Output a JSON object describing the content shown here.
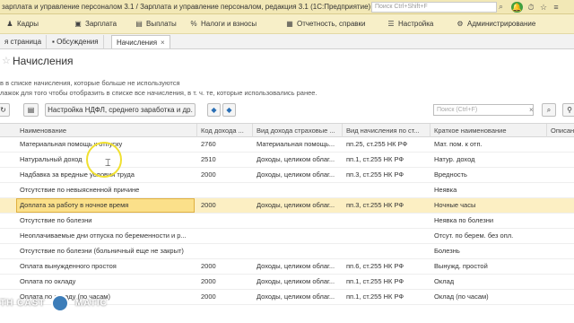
{
  "titlebar": {
    "title": "зарплата и управление персоналом 3.1 / Зарплата и управление персоналом, редакция 3.1  (1С:Предприятие)",
    "search_placeholder": "Поиск Ctrl+Shift+F"
  },
  "menubar": {
    "items": [
      {
        "label": "Кадры",
        "icon": "people-icon"
      },
      {
        "label": "Зарплата",
        "icon": "wallet-icon"
      },
      {
        "label": "Выплаты",
        "icon": "payments-icon"
      },
      {
        "label": "Налоги и взносы",
        "icon": "percent-icon"
      },
      {
        "label": "Отчетность, справки",
        "icon": "report-icon"
      },
      {
        "label": "Настройка",
        "icon": "settings-icon"
      },
      {
        "label": "Администрирование",
        "icon": "admin-icon"
      }
    ]
  },
  "tabs": [
    {
      "label": "я страница"
    },
    {
      "label": "Обсуждения"
    },
    {
      "label": "Начисления"
    }
  ],
  "page": {
    "title": "Начисления",
    "note1": "в в списке начисления, которые больше не используются",
    "note2": "лажок для того чтобы отобразить в списке все начисления, в т. ч. те, которые использовались ранее."
  },
  "toolbar": {
    "settings_button": "Настройка НДФЛ, среднего заработка и др.",
    "filter_placeholder": "Поиск (Ctrl+F)"
  },
  "table": {
    "columns": [
      "Наименование",
      "Код дохода ...",
      "Вид дохода страховые ...",
      "Вид начисления по ст...",
      "Краткое наименование",
      "Описан"
    ],
    "rows": [
      {
        "name": "Материальная помощь к отпуску",
        "code": "2760",
        "vid": "Материальная помощь...",
        "nach": "пп.25, ст.255 НК РФ",
        "short": "Мат. пом. к отп."
      },
      {
        "name": "Натуральный доход",
        "code": "2510",
        "vid": "Доходы, целиком облаг...",
        "nach": "пп.1, ст.255 НК РФ",
        "short": "Натур. доход"
      },
      {
        "name": "Надбавка за вредные условия труда",
        "code": "2000",
        "vid": "Доходы, целиком облаг...",
        "nach": "пп.3, ст.255 НК РФ",
        "short": "Вредность"
      },
      {
        "name": "Отсутствие по невыясненной причине",
        "code": "",
        "vid": "",
        "nach": "",
        "short": "Неявка"
      },
      {
        "name": "Доплата за работу в ночное время",
        "code": "2000",
        "vid": "Доходы, целиком облаг...",
        "nach": "пп.3, ст.255 НК РФ",
        "short": "Ночные часы"
      },
      {
        "name": "Отсутствие по болезни",
        "code": "",
        "vid": "",
        "nach": "",
        "short": "Неявка по болезни"
      },
      {
        "name": "Неоплачиваемые дни отпуска по беременности и р...",
        "code": "",
        "vid": "",
        "nach": "",
        "short": "Отсут. по берем. без опл."
      },
      {
        "name": "Отсутствие по болезни (больничный еще не закрыт)",
        "code": "",
        "vid": "",
        "nach": "",
        "short": "Болезнь"
      },
      {
        "name": "Оплата вынужденного простоя",
        "code": "2000",
        "vid": "Доходы, целиком облаг...",
        "nach": "пп.6, ст.255 НК РФ",
        "short": "Вынужд. простой"
      },
      {
        "name": "Оплата по окладу",
        "code": "2000",
        "vid": "Доходы, целиком облаг...",
        "nach": "пп.1, ст.255 НК РФ",
        "short": "Оклад"
      },
      {
        "name": "Оплата по окладу (по часам)",
        "code": "2000",
        "vid": "Доходы, целиком облаг...",
        "nach": "пп.1, ст.255 НК РФ",
        "short": "Оклад (по часам)"
      }
    ]
  },
  "watermark": {
    "left": "TH",
    "mid": "CAST",
    "right": "MATIC"
  }
}
